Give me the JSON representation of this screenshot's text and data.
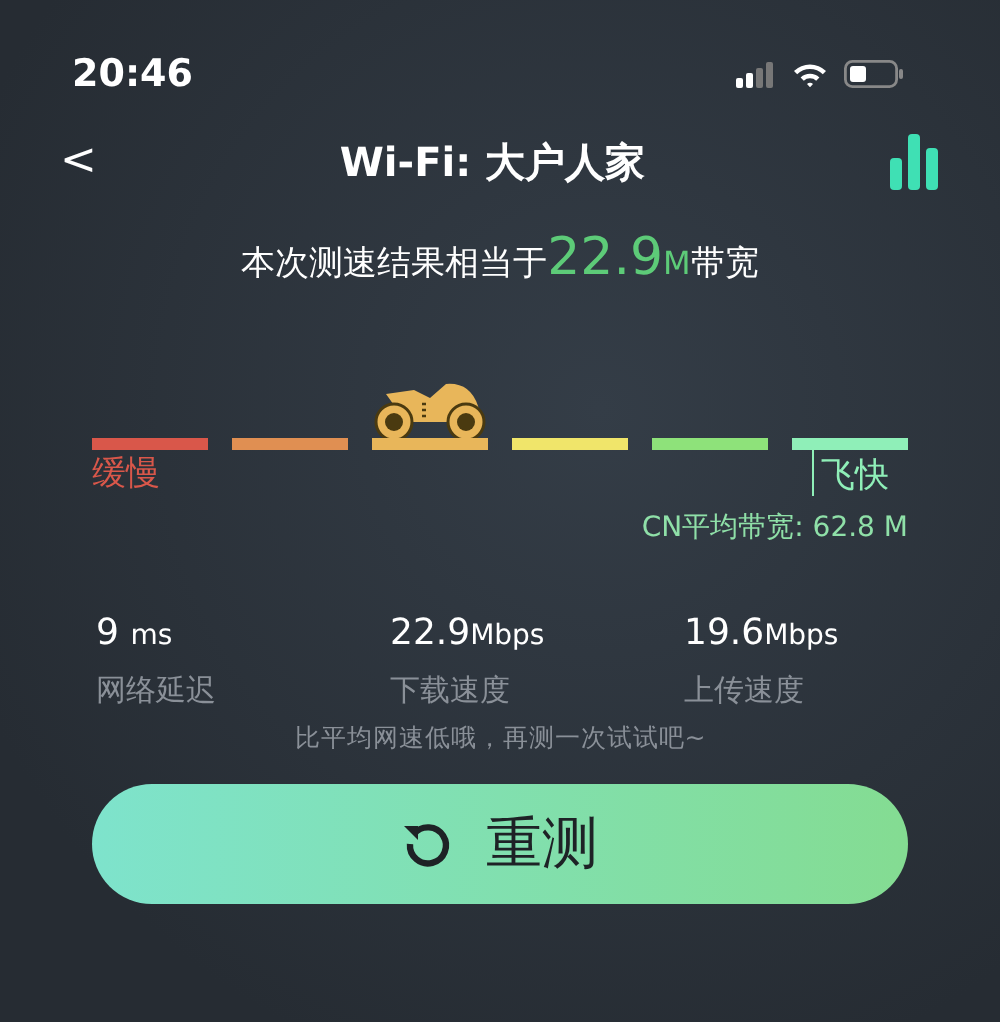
{
  "status_bar": {
    "time": "20:46"
  },
  "nav": {
    "back": "<",
    "title": "Wi-Fi: 大户人家"
  },
  "headline": {
    "prefix": "本次测速结果相当于",
    "value": "22.9",
    "unit": "M",
    "suffix": "带宽"
  },
  "meter": {
    "segments": [
      {
        "color": "#d9574a",
        "selected": false
      },
      {
        "color": "#e08f52",
        "selected": false
      },
      {
        "color": "#e8b65a",
        "selected": true
      },
      {
        "color": "#f0e56a",
        "selected": false
      },
      {
        "color": "#8ee27a",
        "selected": false
      },
      {
        "color": "#8fefb8",
        "selected": false
      }
    ],
    "slow_label": "缓慢",
    "fast_label": "飞快",
    "average": "CN平均带宽: 62.8 M"
  },
  "stats": [
    {
      "value": "9",
      "unit": "ms",
      "spaced": true,
      "label": "网络延迟"
    },
    {
      "value": "22.9",
      "unit": "Mbps",
      "spaced": false,
      "label": "下载速度"
    },
    {
      "value": "19.6",
      "unit": "Mbps",
      "spaced": false,
      "label": "上传速度"
    }
  ],
  "hint": "比平均网速低哦，再测一次试试吧~",
  "retest_button": "重测"
}
